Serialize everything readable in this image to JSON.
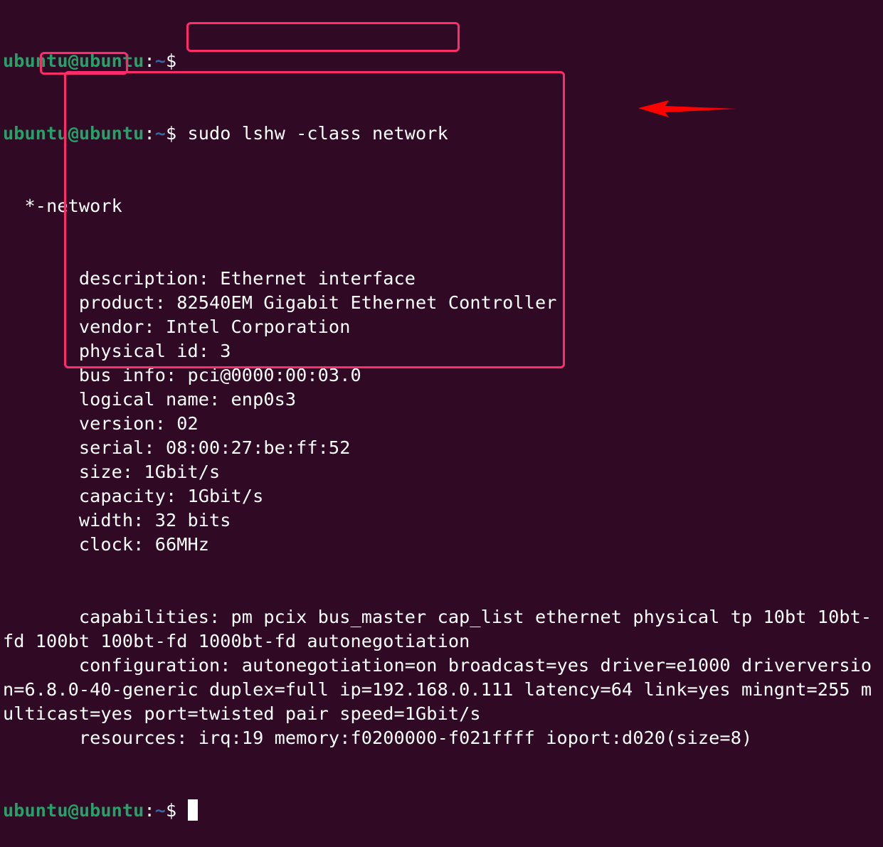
{
  "prompt": {
    "user_host": "ubuntu@ubuntu",
    "sep": ":",
    "path": "~",
    "symbol": "$"
  },
  "command": "sudo lshw -class network",
  "output": {
    "node_prefix": "  *-",
    "node": "network",
    "highlighted_fields": [
      "description: Ethernet interface",
      "product: 82540EM Gigabit Ethernet Controller",
      "vendor: Intel Corporation",
      "physical id: 3",
      "bus info: pci@0000:00:03.0",
      "logical name: enp0s3",
      "version: 02",
      "serial: 08:00:27:be:ff:52",
      "size: 1Gbit/s",
      "capacity: 1Gbit/s",
      "width: 32 bits",
      "clock: 66MHz"
    ],
    "wrapped_lines": [
      "       capabilities: pm pcix bus_master cap_list ethernet physical tp 10bt 10bt-",
      "fd 100bt 100bt-fd 1000bt-fd autonegotiation",
      "       configuration: autonegotiation=on broadcast=yes driver=e1000 driverversio",
      "n=6.8.0-40-generic duplex=full ip=192.168.0.111 latency=64 link=yes mingnt=255 m",
      "ulticast=yes port=twisted pair speed=1Gbit/s",
      "       resources: irq:19 memory:f0200000-f021ffff ioport:d020(size=8)"
    ]
  },
  "colors": {
    "background": "#300a24",
    "user": "#26a269",
    "path": "#3465a4",
    "highlight": "#ff2c6b",
    "arrow": "#ff0000"
  }
}
